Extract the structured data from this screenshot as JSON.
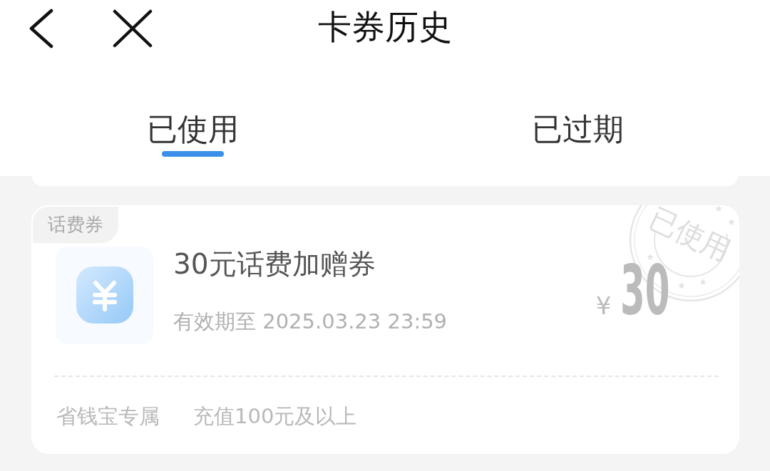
{
  "nav_bar": {
    "title": "卡券历史"
  },
  "tabs": [
    {
      "label": "已使用",
      "selected": true
    },
    {
      "label": "已过期",
      "selected": false
    }
  ],
  "coupons": [
    {
      "used": true,
      "tag": "话费券",
      "title": "30元话费加赠券",
      "validity": "有效期至 2025.03.23 23:59",
      "currency": "¥",
      "amount": "30",
      "stamp": "已使用",
      "conditions": [
        "省钱宝专属",
        "充值100元及以上"
      ]
    }
  ]
}
